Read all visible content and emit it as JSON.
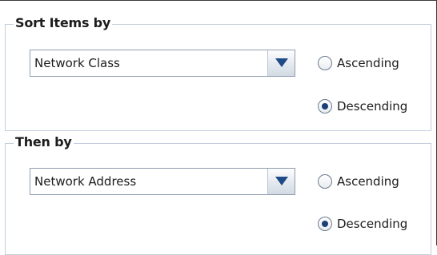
{
  "sort_section": {
    "title": "Sort Items by",
    "field_value": "Network Class",
    "ascending_label": "Ascending",
    "descending_label": "Descending",
    "selected_order": "descending"
  },
  "then_section": {
    "title": "Then by",
    "field_value": "Network Address",
    "ascending_label": "Ascending",
    "descending_label": "Descending",
    "selected_order": "descending"
  },
  "icons": {
    "dropdown": "chevron-down-icon"
  },
  "colors": {
    "group_border": "#c3cfdc",
    "selected_radio": "#1b3f7a",
    "dropdown_arrow": "#1e4a86"
  }
}
